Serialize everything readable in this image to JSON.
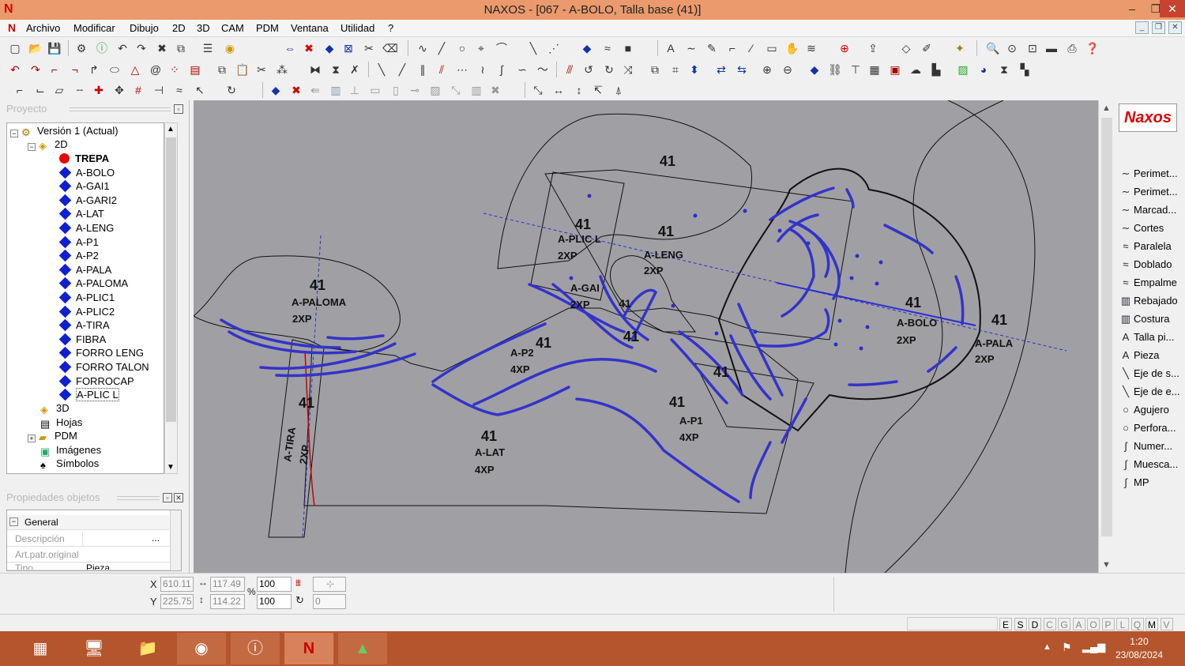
{
  "window": {
    "title": "NAXOS - [067 - A-BOLO, Talla base (41)]",
    "minimize": "–",
    "restore": "❐",
    "close": "✕"
  },
  "menu": [
    "Archivo",
    "Modificar",
    "Dibujo",
    "2D",
    "3D",
    "CAM",
    "PDM",
    "Ventana",
    "Utilidad",
    "?"
  ],
  "panels": {
    "project": "Proyecto",
    "properties": "Propiedades objetos"
  },
  "tree": {
    "version": "Versión 1 (Actual)",
    "group2d": "2D",
    "pieces": [
      "TREPA",
      "A-BOLO",
      "A-GAI1",
      "A-GARI2",
      "A-LAT",
      "A-LENG",
      "A-P1",
      "A-P2",
      "A-PALA",
      "A-PALOMA",
      "A-PLIC1",
      "A-PLIC2",
      "A-TIRA",
      "FIBRA",
      "FORRO LENG",
      "FORRO TALON",
      "FORROCAP",
      "A-PLIC L"
    ],
    "others": [
      "3D",
      "Hojas",
      "PDM",
      "Imágenes",
      "Símbolos"
    ]
  },
  "properties": {
    "section": "General",
    "rows": [
      {
        "label": "Descripción",
        "value": "",
        "extra": "..."
      },
      {
        "label": "Art.patr.original",
        "value": ""
      },
      {
        "label": "Tipo",
        "value": "Pieza"
      }
    ]
  },
  "canvas": {
    "labels": {
      "paloma": [
        "41",
        "A-PALOMA",
        "2XP"
      ],
      "tira": [
        "41",
        "A-TIRA",
        "2XP"
      ],
      "plic": [
        "41",
        "A-PLIC L",
        "2XP"
      ],
      "leng": [
        "41",
        "A-LENG",
        "2XP"
      ],
      "gai": [
        "A-GAI",
        "2XP",
        "41"
      ],
      "p2": [
        "41",
        "A-P2",
        "4XP"
      ],
      "lat": [
        "41",
        "A-LAT",
        "4XP"
      ],
      "p1": [
        "41",
        "A-P1",
        "4XP"
      ],
      "bolo": [
        "41",
        "A-BOLO",
        "2XP"
      ],
      "pala": [
        "41",
        "A-PALA",
        "2XP"
      ],
      "top41": "41",
      "mid41a": "41",
      "mid41b": "41"
    }
  },
  "right_tools": [
    "Perimet...",
    "Perimet...",
    "Marcad...",
    "Cortes",
    "Paralela",
    "Doblado",
    "Empalme",
    "Rebajado",
    "Costura",
    "Talla pi...",
    "Pieza",
    "Eje de s...",
    "Eje de e...",
    "Agujero",
    "Perfora...",
    "Numer...",
    "Muesca...",
    "MP"
  ],
  "coords": {
    "x_label": "X",
    "y_label": "Y",
    "x": "610.11",
    "y": "225.75",
    "w": "117.49",
    "h": "114.22",
    "sx": "100",
    "sy": "100",
    "pct": "%",
    "rot": "0"
  },
  "status_letters": [
    "E",
    "S",
    "D",
    "C",
    "G",
    "A",
    "O",
    "P",
    "L",
    "Q",
    "M",
    "V"
  ],
  "clock": {
    "time": "1:20",
    "date": "23/08/2024"
  }
}
